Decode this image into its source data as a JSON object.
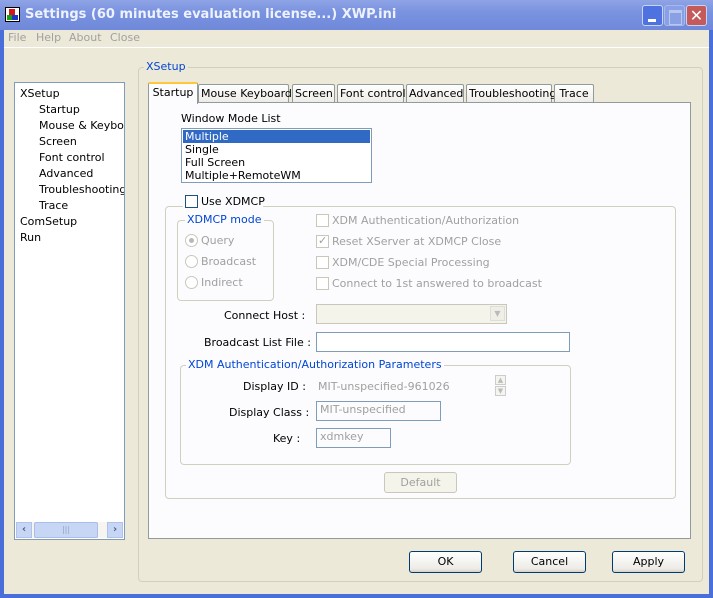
{
  "window": {
    "title": "Settings (60 minutes evaluation license...) XWP.ini",
    "controls": {
      "minimize": "_",
      "maximize": "□",
      "close": "✕"
    }
  },
  "menu": [
    "File",
    "Help",
    "About",
    "Close"
  ],
  "tree": {
    "items": [
      {
        "label": "XSetup",
        "level": 0
      },
      {
        "label": "Startup",
        "level": 1
      },
      {
        "label": "Mouse & Keyboar",
        "level": 1
      },
      {
        "label": "Screen",
        "level": 1
      },
      {
        "label": "Font control",
        "level": 1
      },
      {
        "label": "Advanced",
        "level": 1
      },
      {
        "label": "Troubleshooting",
        "level": 1
      },
      {
        "label": "Trace",
        "level": 1
      },
      {
        "label": "ComSetup",
        "level": 0
      },
      {
        "label": "Run",
        "level": 0
      }
    ],
    "scroll_left": "‹",
    "scroll_right": "›",
    "thumb_grip": "|||"
  },
  "group_label": "XSetup",
  "tabs": [
    {
      "label": "Startup",
      "active": true
    },
    {
      "label": "Mouse  Keyboard",
      "active": false
    },
    {
      "label": "Screen",
      "active": false
    },
    {
      "label": "Font control",
      "active": false
    },
    {
      "label": "Advanced",
      "active": false
    },
    {
      "label": "Troubleshooting",
      "active": false
    },
    {
      "label": "Trace",
      "active": false
    }
  ],
  "startup": {
    "window_mode_label": "Window Mode List",
    "window_modes": [
      "Multiple",
      "Single",
      "Full Screen",
      "Multiple+RemoteWM"
    ],
    "selected_mode": "Multiple",
    "use_xdmcp": {
      "label": "Use XDMCP",
      "checked": false
    },
    "xdmcp_mode": {
      "label": "XDMCP mode",
      "options": [
        "Query",
        "Broadcast",
        "Indirect"
      ],
      "selected": "Query"
    },
    "options": [
      {
        "label": "XDM Authentication/Authorization",
        "checked": false
      },
      {
        "label": "Reset XServer at XDMCP Close",
        "checked": true
      },
      {
        "label": "XDM/CDE Special Processing",
        "checked": false
      },
      {
        "label": "Connect to 1st answered to broadcast",
        "checked": false
      }
    ],
    "connect_host": {
      "label": "Connect Host :",
      "value": ""
    },
    "broadcast_list_file": {
      "label": "Broadcast List File :",
      "value": ""
    },
    "auth_params": {
      "label": "XDM Authentication/Authorization Parameters",
      "display_id": {
        "label": "Display ID :",
        "value": "MIT-unspecified-961026"
      },
      "display_class": {
        "label": "Display Class :",
        "value": "MIT-unspecified"
      },
      "key": {
        "label": "Key :",
        "value": "xdmkey"
      }
    },
    "default_button": "Default"
  },
  "buttons": {
    "ok": "OK",
    "cancel": "Cancel",
    "apply": "Apply"
  }
}
